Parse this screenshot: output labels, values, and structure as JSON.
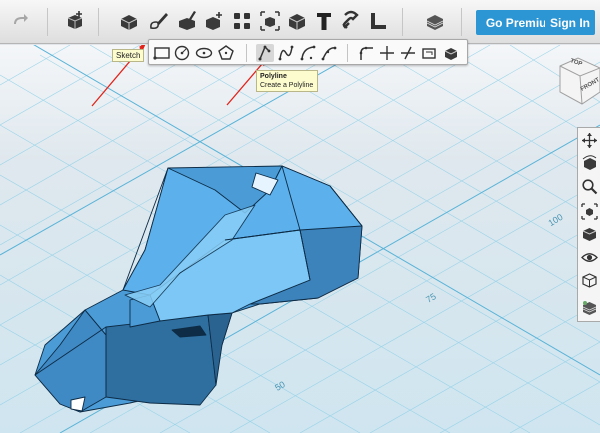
{
  "toolbar": {
    "go_premium_label": "Go Premium",
    "sign_in_label": "Sign In",
    "accent_color": "#2c95d3"
  },
  "sketch_tooltip": {
    "text": "Sketch"
  },
  "polyline_tooltip": {
    "title": "Polyline",
    "description": "Create a Polyline"
  },
  "viewcube": {
    "top_label": "TOP",
    "front_label": "FRONT"
  },
  "grid_labels": {
    "label_100": "100",
    "label_75": "75",
    "label_50": "50"
  },
  "colors": {
    "grid": "#8fd0e8",
    "model": "#5aace8",
    "model_dark": "#2f6f9f"
  }
}
